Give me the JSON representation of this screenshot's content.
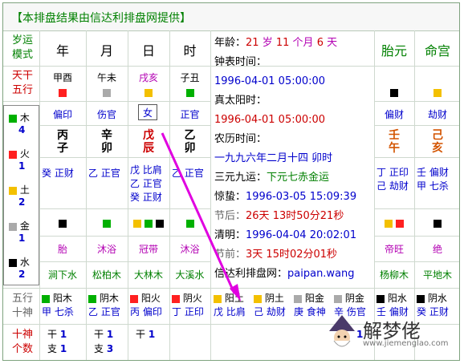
{
  "header": {
    "title": "【本排盘结果由信达利排盘网提供】"
  },
  "colors": {
    "accent": "#008000",
    "row_label": "#cc0000",
    "link": "#0000cc",
    "arrow": "#e000e0"
  },
  "left": {
    "row1": "岁运模式",
    "row2": "天干五行",
    "wuxing": [
      {
        "name": "木",
        "count": "4",
        "color": "green"
      },
      {
        "name": "火",
        "count": "1",
        "color": "red"
      },
      {
        "name": "土",
        "count": "2",
        "color": "yellow"
      },
      {
        "name": "金",
        "count": "1",
        "color": "gray"
      },
      {
        "name": "水",
        "count": "2",
        "color": "black"
      }
    ],
    "row_shishen": "五行十神",
    "row_count": "十神个数"
  },
  "pillars": {
    "headers": [
      "年",
      "月",
      "日",
      "时"
    ],
    "nayin_gz": [
      "甲酉",
      "午未",
      "戌亥",
      "子丑"
    ],
    "shishen": [
      "偏印",
      "伤官",
      "女",
      "正官"
    ],
    "stems": [
      "丙",
      "辛",
      "戊",
      "乙"
    ],
    "branches": [
      "子",
      "卯",
      "辰",
      "卯"
    ],
    "cangan": [
      [
        "癸 正财"
      ],
      [
        "乙 正官"
      ],
      [
        "戊 比肩",
        "乙 正官",
        "癸 正财"
      ],
      [
        "乙 正官"
      ]
    ],
    "changsheng": [
      "胎",
      "沐浴",
      "冠带",
      "沐浴"
    ],
    "nayin": [
      "涧下水",
      "松柏木",
      "大林木",
      "大溪水"
    ]
  },
  "info": {
    "age_label": "年龄：",
    "age_years": "21",
    "sui": "岁",
    "age_months": "11",
    "months_label": "个月",
    "age_days": "6",
    "days_label": "天",
    "clock_label": "钟表时间：",
    "clock_value": "1996-04-01 05:00:00",
    "solar_label": "真太阳时：",
    "solar_value": "1996-04-01 05:00:00",
    "lunar_label": "农历时间：",
    "lunar_value": "一九九六年二月十四 卯时",
    "yuan_label": "三元九运：",
    "yuan_value": "下元七赤金运",
    "jingzhe_label": "惊蛰：",
    "jingzhe_value": "1996-03-05 15:09:39",
    "after_label": "节后：",
    "after_value": "26天 13时50分21秒",
    "qingming_label": "清明：",
    "qingming_value": "1996-04-04 20:02:01",
    "before_label": "节前：",
    "before_value": "3天 15时02分01秒",
    "site_label": "信达利排盘网：",
    "site_value": "paipan.wang"
  },
  "right": {
    "headers": [
      "胎元",
      "命宫"
    ],
    "gz": [
      [
        "壬",
        "午"
      ],
      [
        "己",
        "亥"
      ]
    ],
    "shishen": [
      "偏财",
      "劫财"
    ],
    "cangan": [
      [
        "丁 正印",
        "己 劫财"
      ],
      [
        "壬 偏财",
        "甲 七杀"
      ]
    ],
    "changsheng": [
      "帝旺",
      "绝"
    ],
    "nayin": [
      "杨柳木",
      "平地木"
    ]
  },
  "bottom": {
    "wuxing_shishen": [
      [
        "阳木",
        "甲 七杀"
      ],
      [
        "阴木",
        "乙 正官"
      ],
      [
        "阳火",
        "丙 偏印"
      ],
      [
        "阴火",
        "丁 正印"
      ],
      [
        "阳土",
        "戊 比肩"
      ],
      [
        "阴土",
        "己 劫财"
      ],
      [
        "阳金",
        "庚 食神"
      ],
      [
        "阴金",
        "辛 伤官"
      ],
      [
        "阳水",
        "壬 偏财"
      ],
      [
        "阴水",
        "癸 正财"
      ]
    ],
    "counts": [
      {
        "gan": "干",
        "gv": "1",
        "zhi": "支",
        "zv": "1"
      },
      {
        "gan": "干",
        "gv": "1",
        "zhi": "支",
        "zv": "3"
      },
      {
        "gan": "干",
        "gv": "1",
        "zhi": "",
        "zv": ""
      },
      {
        "gan": "",
        "gv": "",
        "zhi": "",
        "zv": ""
      },
      {
        "gan": "",
        "gv": "1",
        "zhi": "",
        "zv": ""
      }
    ]
  },
  "watermark": {
    "text": "解梦佬",
    "sub": "www.jiemenglao.com"
  }
}
